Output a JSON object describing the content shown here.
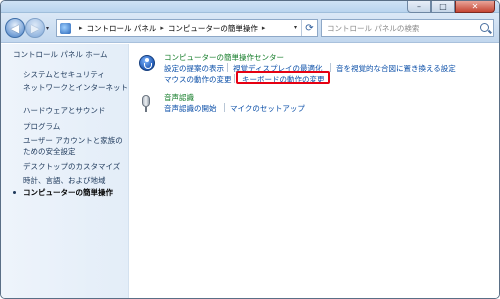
{
  "window": {
    "buttons": {
      "minimize": "–",
      "maximize": "□",
      "close": "✕"
    }
  },
  "address": {
    "back": "◀",
    "forward": "▶",
    "segments": [
      "コントロール パネル",
      "コンピューターの簡単操作"
    ],
    "separator": "▸",
    "dropdown": "▾",
    "refresh": "⟳",
    "search_placeholder": "コントロール パネルの検索"
  },
  "sidebar": {
    "items": [
      "コントロール パネル ホーム",
      "システムとセキュリティ",
      "ネットワークとインターネット",
      "ハードウェアとサウンド",
      "プログラム",
      "ユーザー アカウントと家族の",
      "ための安全設定",
      "デスクトップのカスタマイズ",
      "時計、言語、および地域",
      "コンピューターの簡単操作"
    ]
  },
  "content": {
    "ease_title": "コンピューターの簡単操作センター",
    "ease_links": [
      "設定の提案の表示",
      "視覚ディスプレイの最適化",
      "音を視覚的な合図に置き換える設定",
      "マウスの動作の変更",
      "キーボードの動作の変更"
    ],
    "speech_title": "音声認識",
    "speech_links": [
      "音声認識の開始",
      "マイクのセットアップ"
    ]
  }
}
